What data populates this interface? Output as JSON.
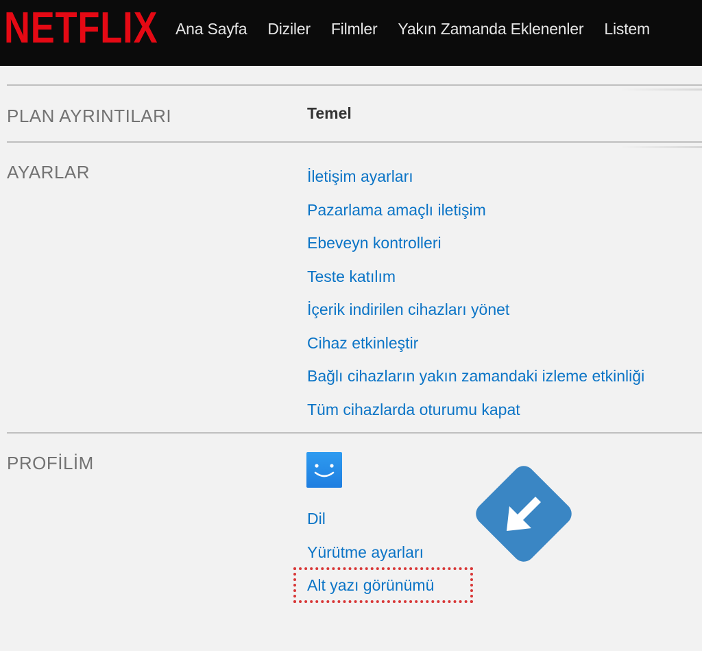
{
  "header": {
    "logo_text": "NETFLIX",
    "nav": [
      "Ana Sayfa",
      "Diziler",
      "Filmler",
      "Yakın Zamanda Eklenenler",
      "Listem"
    ]
  },
  "plan": {
    "label": "PLAN AYRINTILARI",
    "value": "Temel"
  },
  "settings": {
    "label": "AYARLAR",
    "links": [
      "İletişim ayarları",
      "Pazarlama amaçlı iletişim",
      "Ebeveyn kontrolleri",
      "Teste katılım",
      "İçerik indirilen cihazları yönet",
      "Cihaz etkinleştir",
      "Bağlı cihazların yakın zamandaki izleme etkinliği",
      "Tüm cihazlarda oturumu kapat"
    ]
  },
  "profile": {
    "label": "PROFİLİM",
    "avatar_icon": "smiley-face-icon",
    "links": [
      "Dil",
      "Yürütme ayarları",
      "Alt yazı görünümü"
    ]
  },
  "annotation": {
    "arrow_icon": "diagonal-down-left-arrow-icon",
    "highlight_color": "#d83737",
    "badge_color": "#3a86c4"
  },
  "colors": {
    "brand_red": "#e50914",
    "link_blue": "#0b74c6",
    "topbar_bg": "#0b0b0b",
    "page_bg": "#f2f2f2"
  }
}
